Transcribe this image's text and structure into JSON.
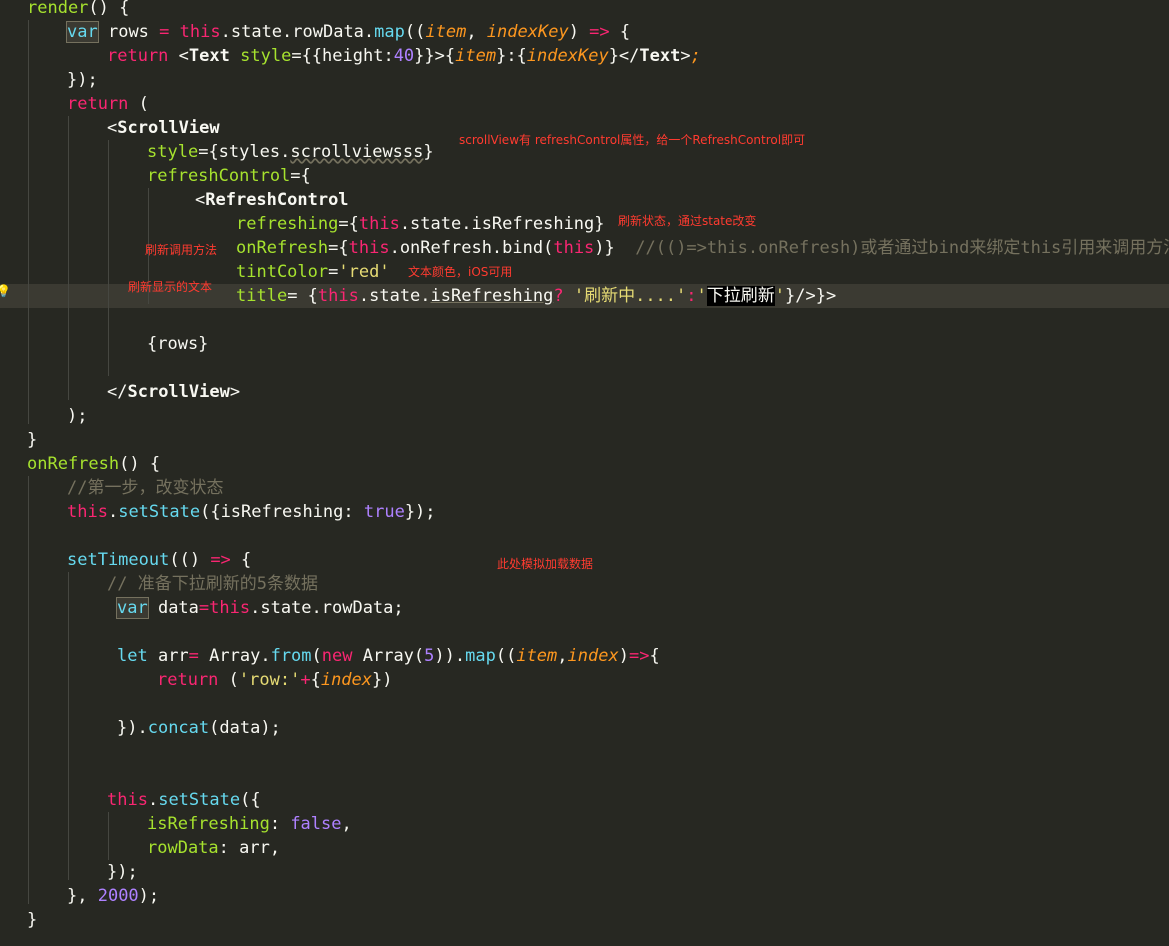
{
  "code": {
    "l1": [
      "render",
      "() {"
    ],
    "l2": [
      "var",
      "rows",
      "=",
      "this",
      ".state.rowData.",
      "map",
      "((",
      "item",
      ", ",
      "indexKey",
      ") ",
      "=>",
      " {"
    ],
    "l3": [
      "return",
      "<",
      "Text",
      "style",
      "=",
      "{{height:",
      "40",
      "}}>{",
      "item",
      "}:{",
      "indexKey",
      "}</",
      "Text",
      ">",
      ";"
    ],
    "l4": [
      "});"
    ],
    "l5": [
      "return",
      " ("
    ],
    "l6": [
      "<",
      "ScrollView"
    ],
    "l7": [
      "style",
      "=",
      "{styles.",
      "scrollviewsss",
      "}"
    ],
    "l8": [
      "refreshControl",
      "=",
      "{"
    ],
    "l9": [
      "<",
      "RefreshControl"
    ],
    "l10": [
      "refreshing",
      "=",
      "{",
      "this",
      ".state.isRefreshing}"
    ],
    "l11": [
      "onRefresh",
      "=",
      "{",
      "this",
      ".onRefresh.bind(",
      "this",
      ")}",
      "  //(()=>this.onRefresh)或者通过bind来绑定this引用来调用方法"
    ],
    "l12": [
      "tintColor",
      "=",
      "'red'"
    ],
    "l13": [
      "title",
      "=",
      " {",
      "this",
      ".state.",
      "isRefreshing",
      "? ",
      "'刷新中....'",
      ":",
      "'",
      "下拉刷新",
      "'",
      "}/>}>"
    ],
    "l15": [
      "{rows}"
    ],
    "l17": [
      "</",
      "ScrollView",
      ">"
    ],
    "l18": [
      ");"
    ],
    "l19": [
      "}"
    ],
    "l20": [
      "onRefresh",
      "() {"
    ],
    "l21": [
      "//第一步，改变状态"
    ],
    "l22": [
      "this",
      ".",
      "setState",
      "({isRefreshing: ",
      "true",
      "});"
    ],
    "l24": [
      "setTimeout",
      "(() ",
      "=>",
      " {"
    ],
    "l25": [
      "// 准备下拉刷新的5条数据"
    ],
    "l26": [
      "var",
      " data",
      "=",
      "this",
      ".state.rowData;"
    ],
    "l28": [
      "let",
      " arr",
      "=",
      " Array.",
      "from",
      "(",
      "new",
      " Array(",
      "5",
      ")).",
      "map",
      "((",
      "item",
      ",",
      "index",
      ")",
      "=>",
      "{"
    ],
    "l29": [
      "return",
      " (",
      "'row:'",
      "+",
      "{",
      "index",
      "})"
    ],
    "l31": [
      "}).",
      "concat",
      "(data);"
    ],
    "l34": [
      "this",
      ".",
      "setState",
      "({"
    ],
    "l35": [
      "isRefreshing",
      ": ",
      "false",
      ","
    ],
    "l36": [
      "rowData",
      ": ",
      "arr",
      ","
    ],
    "l37": [
      "});"
    ],
    "l38": [
      "}, ",
      "2000",
      ");"
    ],
    "l39": [
      "}"
    ]
  },
  "annotations": {
    "scrollview_note": "scrollView有 refreshControl属性，给一个RefreshControl即可",
    "refreshing_note": "刷新状态，通过state改变",
    "onrefresh_note": "刷新调用方法",
    "tint_note": "文本颜色，iOS可用",
    "title_note": "刷新显示的文本",
    "simulate_note": "此处模拟加载数据"
  },
  "colors": {
    "background": "#272822",
    "keyword": "#f92672",
    "type": "#66d9ef",
    "string": "#e6db74",
    "number": "#ae81ff",
    "param": "#fd971f",
    "comment": "#75715e",
    "function": "#a6e22e",
    "annotation": "#ff3b30"
  },
  "icons": {
    "gutter": "lightbulb-icon"
  }
}
